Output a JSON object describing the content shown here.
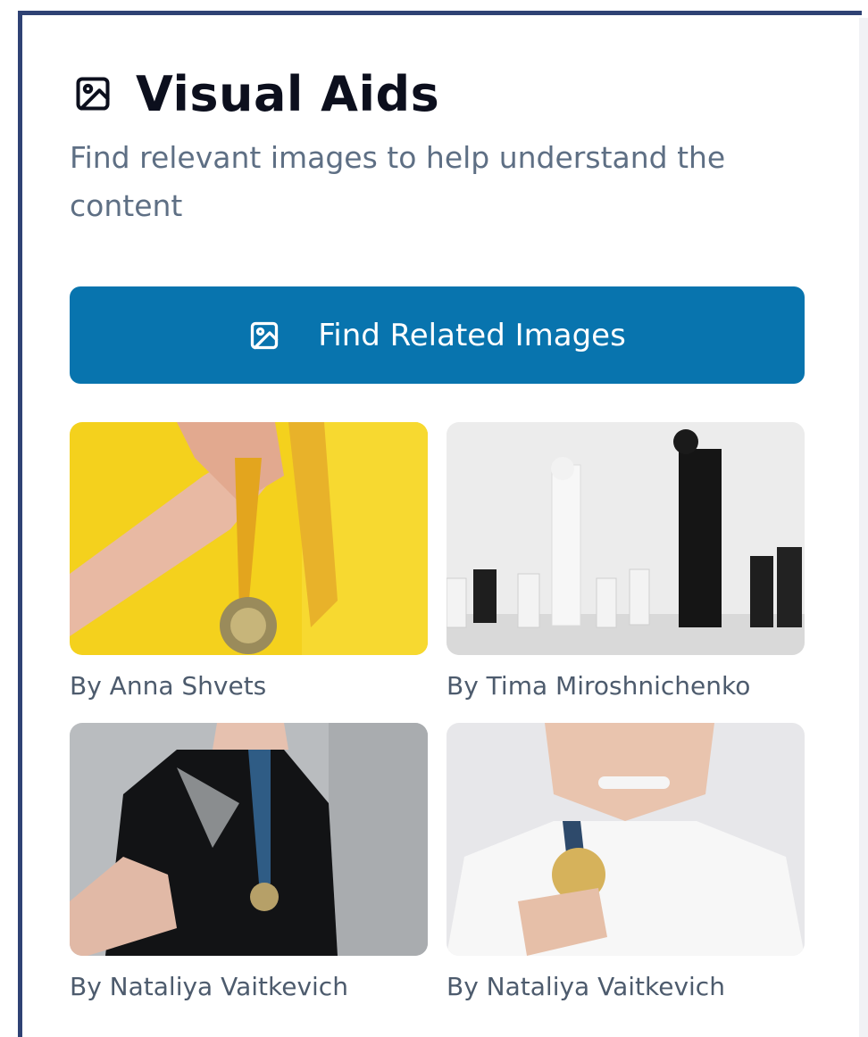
{
  "panel": {
    "title": "Visual Aids",
    "title_icon": "image-icon",
    "subtitle": "Find relevant images to help understand the content"
  },
  "find_button": {
    "label": "Find Related Images",
    "icon": "image-icon",
    "color": "#0874ae"
  },
  "images": [
    {
      "credit": "By Anna Shvets"
    },
    {
      "credit": "By Tima Miroshnichenko"
    },
    {
      "credit": "By Nataliya Vaitkevich"
    },
    {
      "credit": "By Nataliya Vaitkevich"
    }
  ],
  "colors": {
    "accent": "#0874ae",
    "panel_border": "#2f4274",
    "title": "#0c0f1d",
    "subtitle": "#5e6f84",
    "credit": "#4d5b6d"
  }
}
